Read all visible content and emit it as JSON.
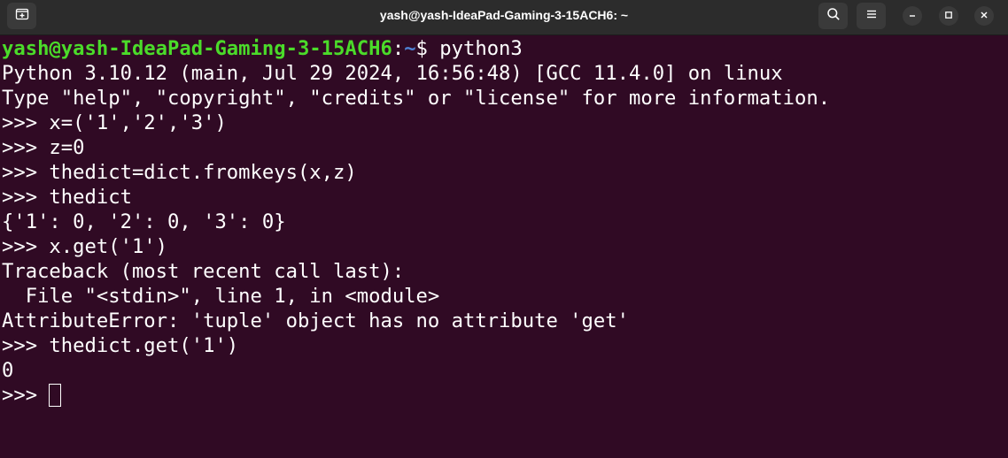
{
  "window": {
    "title": "yash@yash-IdeaPad-Gaming-3-15ACH6: ~",
    "icons": {
      "new_tab": "new-tab-icon",
      "search": "search-icon",
      "menu": "hamburger-menu-icon",
      "minimize": "minimize-icon",
      "maximize": "maximize-icon",
      "close": "close-icon"
    }
  },
  "colors": {
    "background": "#300a24",
    "titlebar": "#2c2c2c",
    "prompt_user": "#4bdb2a",
    "prompt_path": "#4f83d6",
    "text": "#ffffff"
  },
  "terminal": {
    "prompt": {
      "user_host": "yash@yash-IdeaPad-Gaming-3-15ACH6",
      "colon": ":",
      "path": "~",
      "dollar": "$ ",
      "command": "python3"
    },
    "lines": [
      "Python 3.10.12 (main, Jul 29 2024, 16:56:48) [GCC 11.4.0] on linux",
      "Type \"help\", \"copyright\", \"credits\" or \"license\" for more information.",
      ">>> x=('1','2','3')",
      ">>> z=0",
      ">>> thedict=dict.fromkeys(x,z)",
      ">>> thedict",
      "{'1': 0, '2': 0, '3': 0}",
      ">>> x.get('1')",
      "Traceback (most recent call last):",
      "  File \"<stdin>\", line 1, in <module>",
      "AttributeError: 'tuple' object has no attribute 'get'",
      ">>> thedict.get('1')",
      "0"
    ],
    "current_prompt": ">>> "
  }
}
